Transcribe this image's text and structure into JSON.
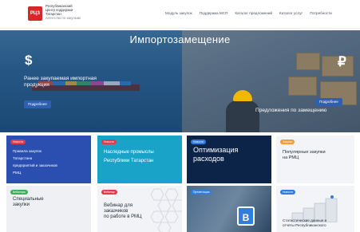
{
  "header": {
    "logo_mark": "РЦЗ",
    "logo_lines": [
      "Республиканский",
      "Центр поддержки",
      "и",
      "закупок",
      "Татарстан"
    ],
    "logo_subline": "Агентство по закупкам",
    "nav": [
      "Модуль закупок",
      "Поддержка МСП",
      "Каталог предложений",
      "Каталог услуг",
      "Потребности"
    ]
  },
  "hero": {
    "title": "Импортозамещение",
    "left_icon": "$",
    "left_caption": "Ранее закупаемая импортная продукция",
    "left_button": "Подробнее",
    "right_icon": "₽",
    "right_caption": "Предложения по замещению",
    "right_button": "Подробнее"
  },
  "cards": [
    {
      "badge": "Новости",
      "text_lines": [
        "Правила закупок",
        "Татарстана",
        "предприятий и заказчиков",
        "РМЦ"
      ]
    },
    {
      "badge": "Новости",
      "text_lines": [
        "Наследные промыслы",
        "Республики Татарстан"
      ]
    },
    {
      "badge": "Новости",
      "text_lines": [
        "Оптимизация",
        "расходов"
      ]
    },
    {
      "badge": "Закупки",
      "text_lines": [
        "Популярные закупки",
        "на РМЦ"
      ]
    },
    {
      "badge": "Вебинары",
      "text_lines": [
        "Специальные",
        "закупки"
      ]
    },
    {
      "badge": "Вебинар",
      "text_lines": [
        "Вебинар для",
        "заказчиков",
        "по работе в РМЦ"
      ]
    },
    {
      "badge": "Презентация",
      "text_lines": [],
      "icon_glyph": "В"
    },
    {
      "badge": "Новости",
      "text_lines": [
        "Статистические данные и",
        "отчеты Республиканского"
      ]
    }
  ]
}
